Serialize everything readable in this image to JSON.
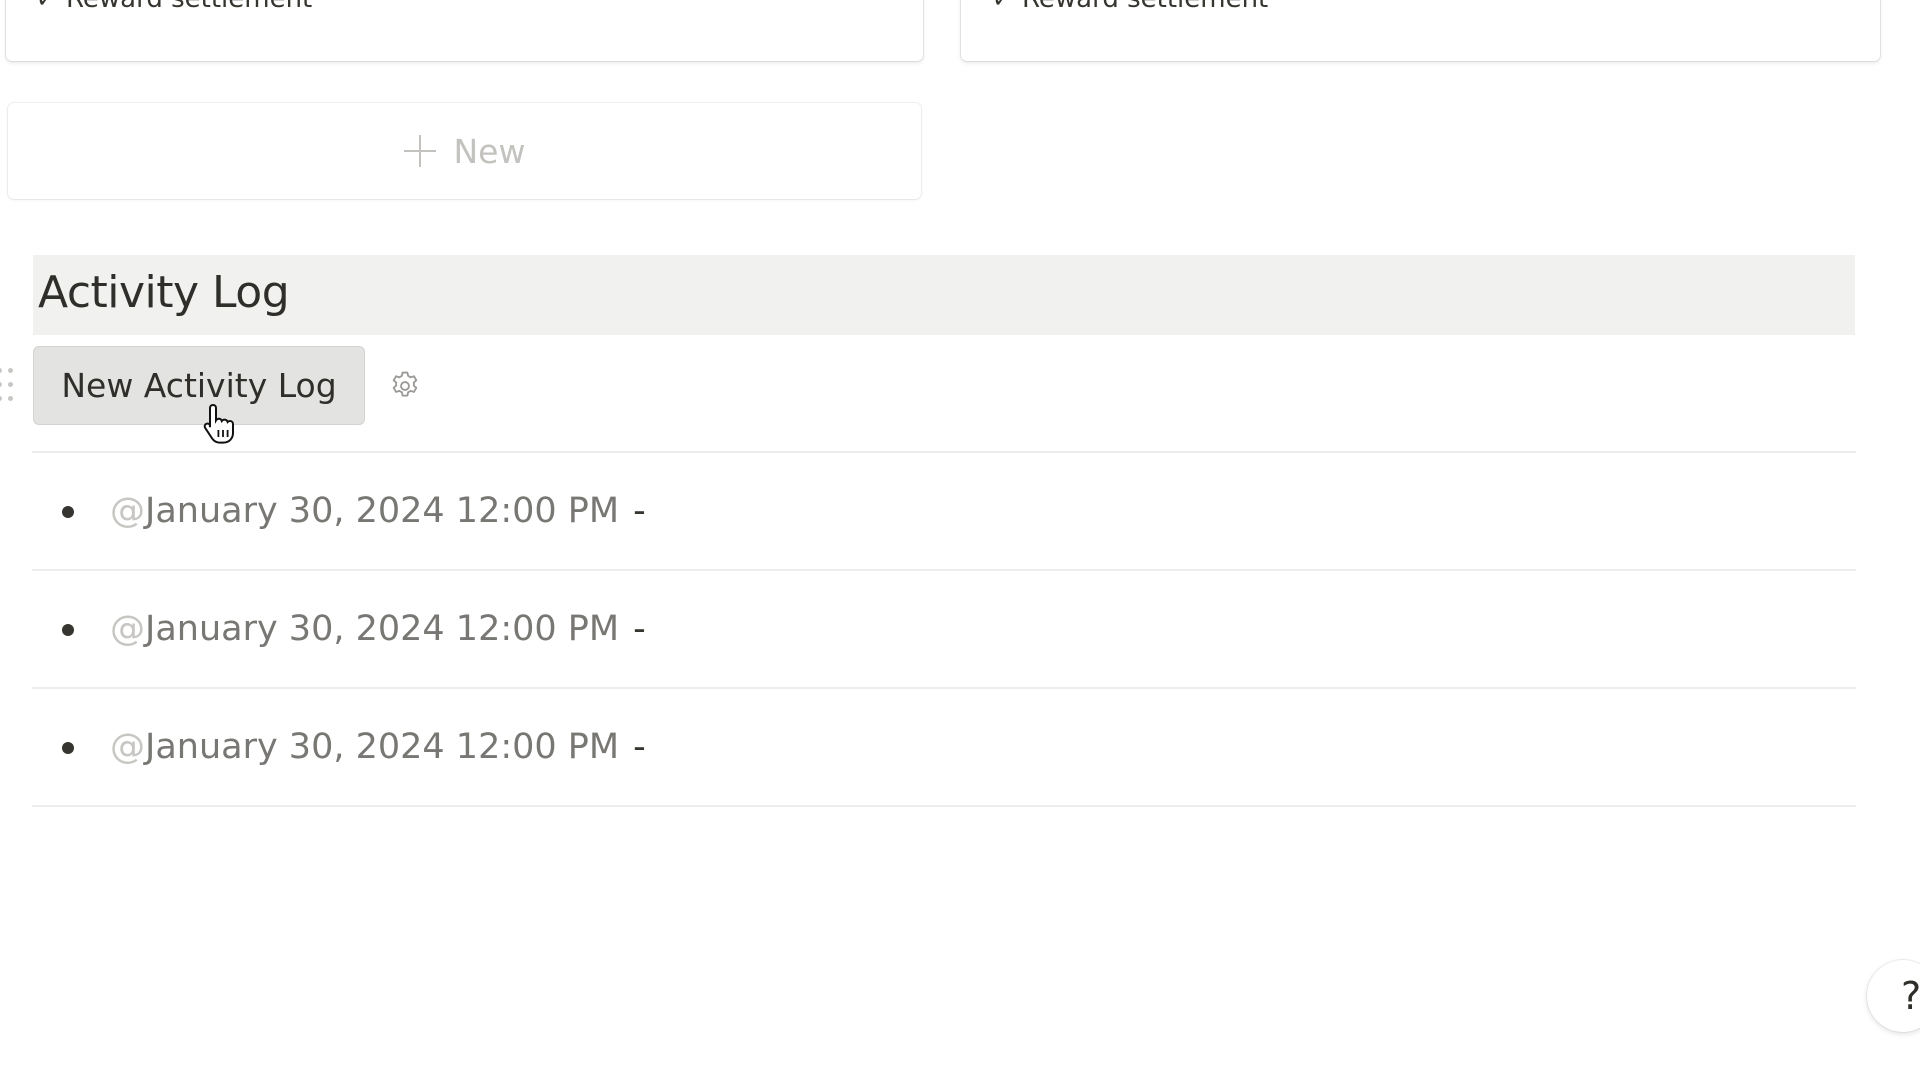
{
  "board": {
    "cards": [
      {
        "property_icon": "checkmark-icon",
        "check_glyph": "✓",
        "property_label": "Reward settlement"
      },
      {
        "property_icon": "checkmark-icon",
        "check_glyph": "✓",
        "property_label": "Reward settlement"
      }
    ],
    "new_card": {
      "icon": "plus-icon",
      "label": "New"
    }
  },
  "activity_log": {
    "title": "Activity Log",
    "template_button": {
      "label": "New Activity Log"
    },
    "settings_icon": "gear-icon",
    "entries": [
      {
        "mention_prefix": "@",
        "datetime": "January 30, 2024 12:00 PM",
        "separator": "-"
      },
      {
        "mention_prefix": "@",
        "datetime": "January 30, 2024 12:00 PM",
        "separator": "-"
      },
      {
        "mention_prefix": "@",
        "datetime": "January 30, 2024 12:00 PM",
        "separator": "-"
      }
    ]
  },
  "help": {
    "icon": "question-icon",
    "label": "?"
  },
  "colors": {
    "header_bg": "#f1f1ef",
    "button_bg": "#e3e3e1",
    "text": "#37352f",
    "date_text": "#787774",
    "mention_at": "#c7c6c3",
    "placeholder": "#c3c2bf",
    "divider": "#ededec"
  }
}
